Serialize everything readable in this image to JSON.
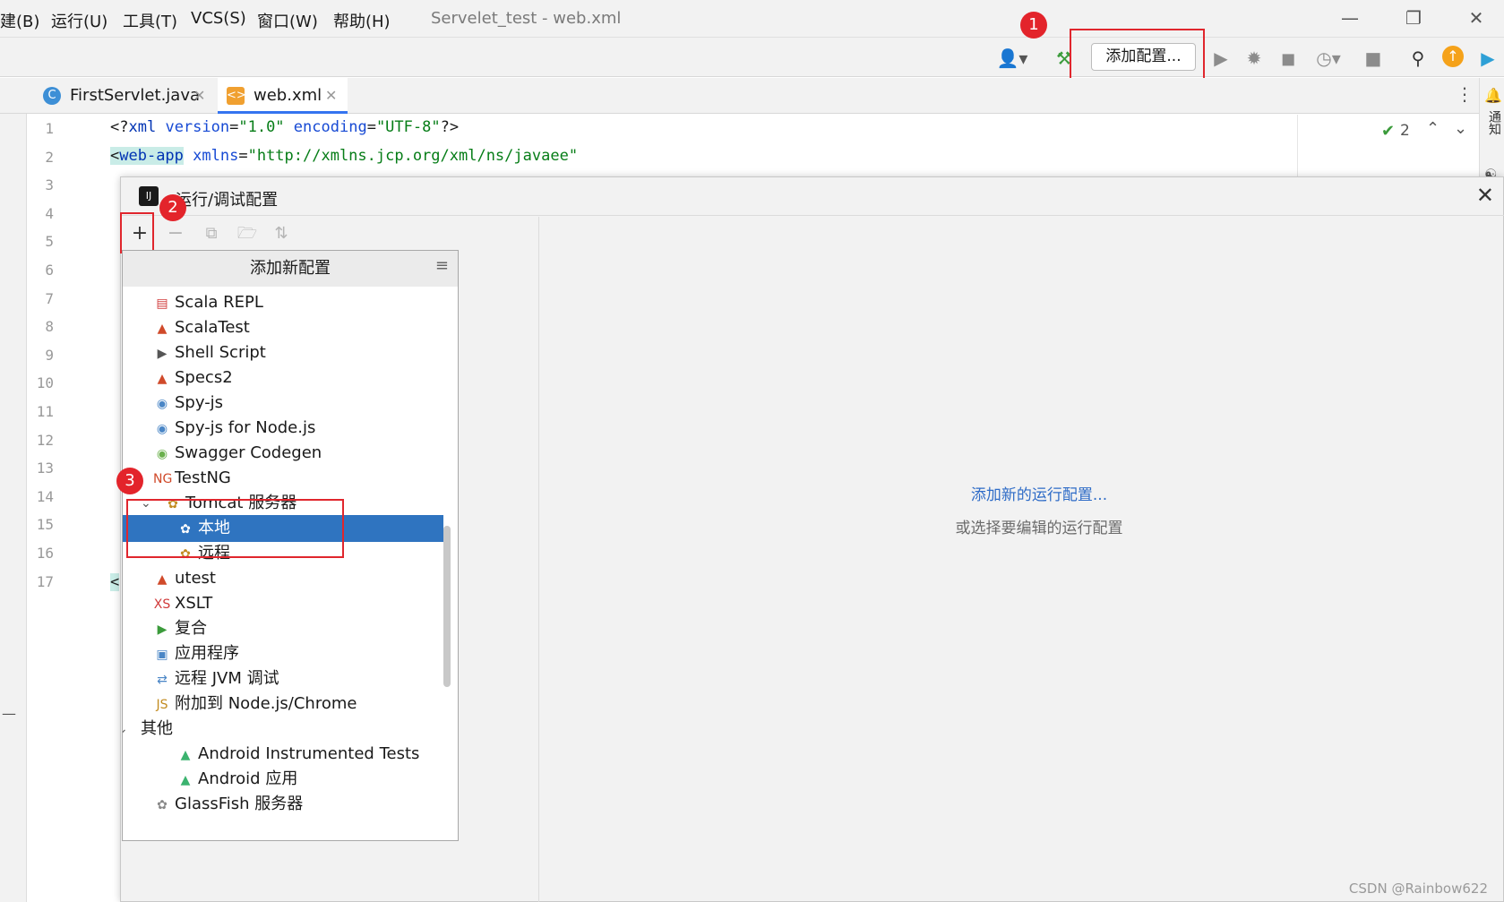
{
  "menu": {
    "items": [
      "建(B)",
      "运行(U)",
      "工具(T)",
      "VCS(S)",
      "窗口(W)",
      "帮助(H)"
    ],
    "window_title": "Servelet_test - web.xml"
  },
  "toolbar": {
    "add_config_label": "添加配置..."
  },
  "badges": [
    "1",
    "2",
    "3"
  ],
  "tabs": [
    {
      "label": "FirstServlet.java",
      "icon_letter": "C"
    },
    {
      "label": "web.xml"
    }
  ],
  "editor": {
    "line_numbers": [
      "1",
      "2",
      "3",
      "4",
      "5",
      "6",
      "7",
      "8",
      "9",
      "10",
      "11",
      "12",
      "13",
      "14",
      "15",
      "16",
      "17"
    ],
    "line1": {
      "p1": "<?",
      "tag": "xml",
      "a1": "version",
      "eq1": "=",
      "v1": "\"1.0\"",
      "a2": "encoding",
      "eq2": "=",
      "v2": "\"UTF-8\"",
      "p2": "?>"
    },
    "line2": {
      "p1": "<",
      "tag": "web-app",
      "a1": "xmlns",
      "eq1": "=",
      "v1": "\"http://xmlns.jcp.org/xml/ns/javaee\""
    },
    "line17": "<",
    "inspection_count": "2",
    "right_strip_label": "通知"
  },
  "dialog": {
    "title": "运行/调试配置",
    "popup_header": "添加新配置",
    "items": [
      {
        "label": "Scala REPL",
        "icon": "scala-repl-icon"
      },
      {
        "label": "ScalaTest",
        "icon": "scalatest-icon"
      },
      {
        "label": "Shell Script",
        "icon": "shell-script-icon"
      },
      {
        "label": "Specs2",
        "icon": "specs2-icon"
      },
      {
        "label": "Spy-js",
        "icon": "spy-js-icon"
      },
      {
        "label": "Spy-js for Node.js",
        "icon": "spy-js-node-icon"
      },
      {
        "label": "Swagger Codegen",
        "icon": "swagger-icon"
      },
      {
        "label": "TestNG",
        "icon": "testng-icon"
      },
      {
        "label": "Tomcat 服务器",
        "icon": "tomcat-icon"
      },
      {
        "label": "本地",
        "icon": "tomcat-icon"
      },
      {
        "label": "远程",
        "icon": "tomcat-icon"
      },
      {
        "label": "utest",
        "icon": "utest-icon"
      },
      {
        "label": "XSLT",
        "icon": "xslt-icon"
      },
      {
        "label": "复合",
        "icon": "compound-icon"
      },
      {
        "label": "应用程序",
        "icon": "application-icon"
      },
      {
        "label": "远程 JVM 调试",
        "icon": "remote-jvm-icon"
      },
      {
        "label": "附加到 Node.js/Chrome",
        "icon": "attach-node-icon"
      },
      {
        "label": "其他",
        "icon": ""
      },
      {
        "label": "Android Instrumented Tests",
        "icon": "android-icon"
      },
      {
        "label": "Android 应用",
        "icon": "android-icon"
      },
      {
        "label": "GlassFish 服务器",
        "icon": "glassfish-icon"
      }
    ],
    "empty_link": "添加新的运行配置...",
    "empty_hint": "或选择要编辑的运行配置"
  },
  "watermark": "CSDN @Rainbow622",
  "colors": {
    "selection": "#2f74c0",
    "highlight": "#e0262d",
    "link": "#2f6cc7"
  }
}
